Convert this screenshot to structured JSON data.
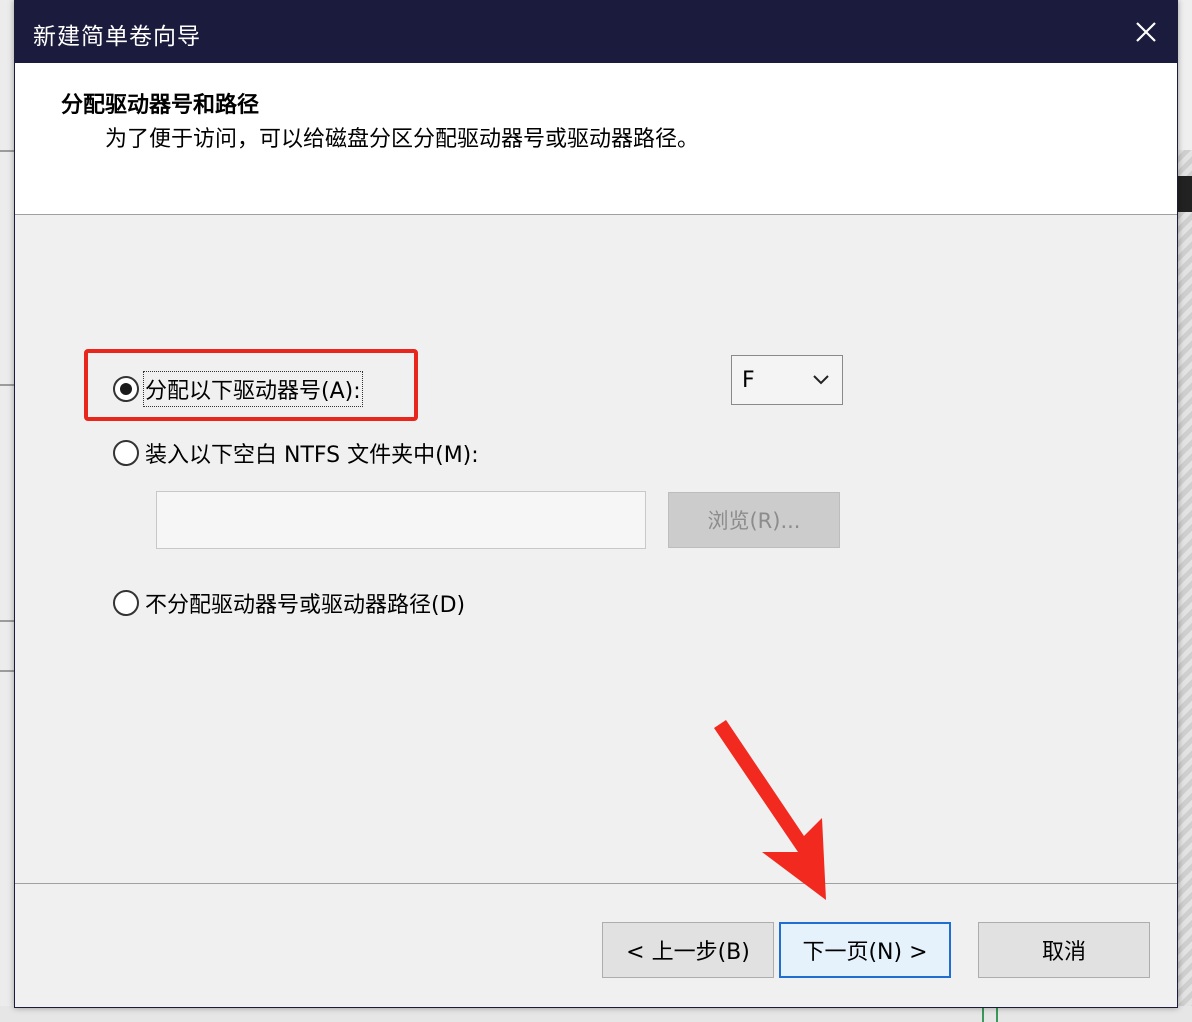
{
  "window": {
    "title": "新建简单卷向导"
  },
  "header": {
    "title": "分配驱动器号和路径",
    "subtitle": "为了便于访问，可以给磁盘分区分配驱动器号或驱动器路径。"
  },
  "options": {
    "assign_letter": {
      "label": "分配以下驱动器号(A):",
      "selected": true
    },
    "mount_folder": {
      "label": "装入以下空白 NTFS 文件夹中(M):",
      "selected": false
    },
    "no_assign": {
      "label": "不分配驱动器号或驱动器路径(D)",
      "selected": false
    }
  },
  "drive_letter": {
    "value": "F"
  },
  "folder_path": {
    "value": "",
    "placeholder": ""
  },
  "buttons": {
    "browse": "浏览(R)...",
    "back": "< 上一步(B)",
    "next": "下一页(N) >",
    "cancel": "取消"
  },
  "colors": {
    "titlebar": "#1b1b3d",
    "highlight": "#e8261c",
    "focus_button": "#1e6fd1"
  },
  "icons": {
    "close": "close-icon",
    "dropdown": "chevron-down-icon",
    "annotation": "red-arrow-icon"
  }
}
